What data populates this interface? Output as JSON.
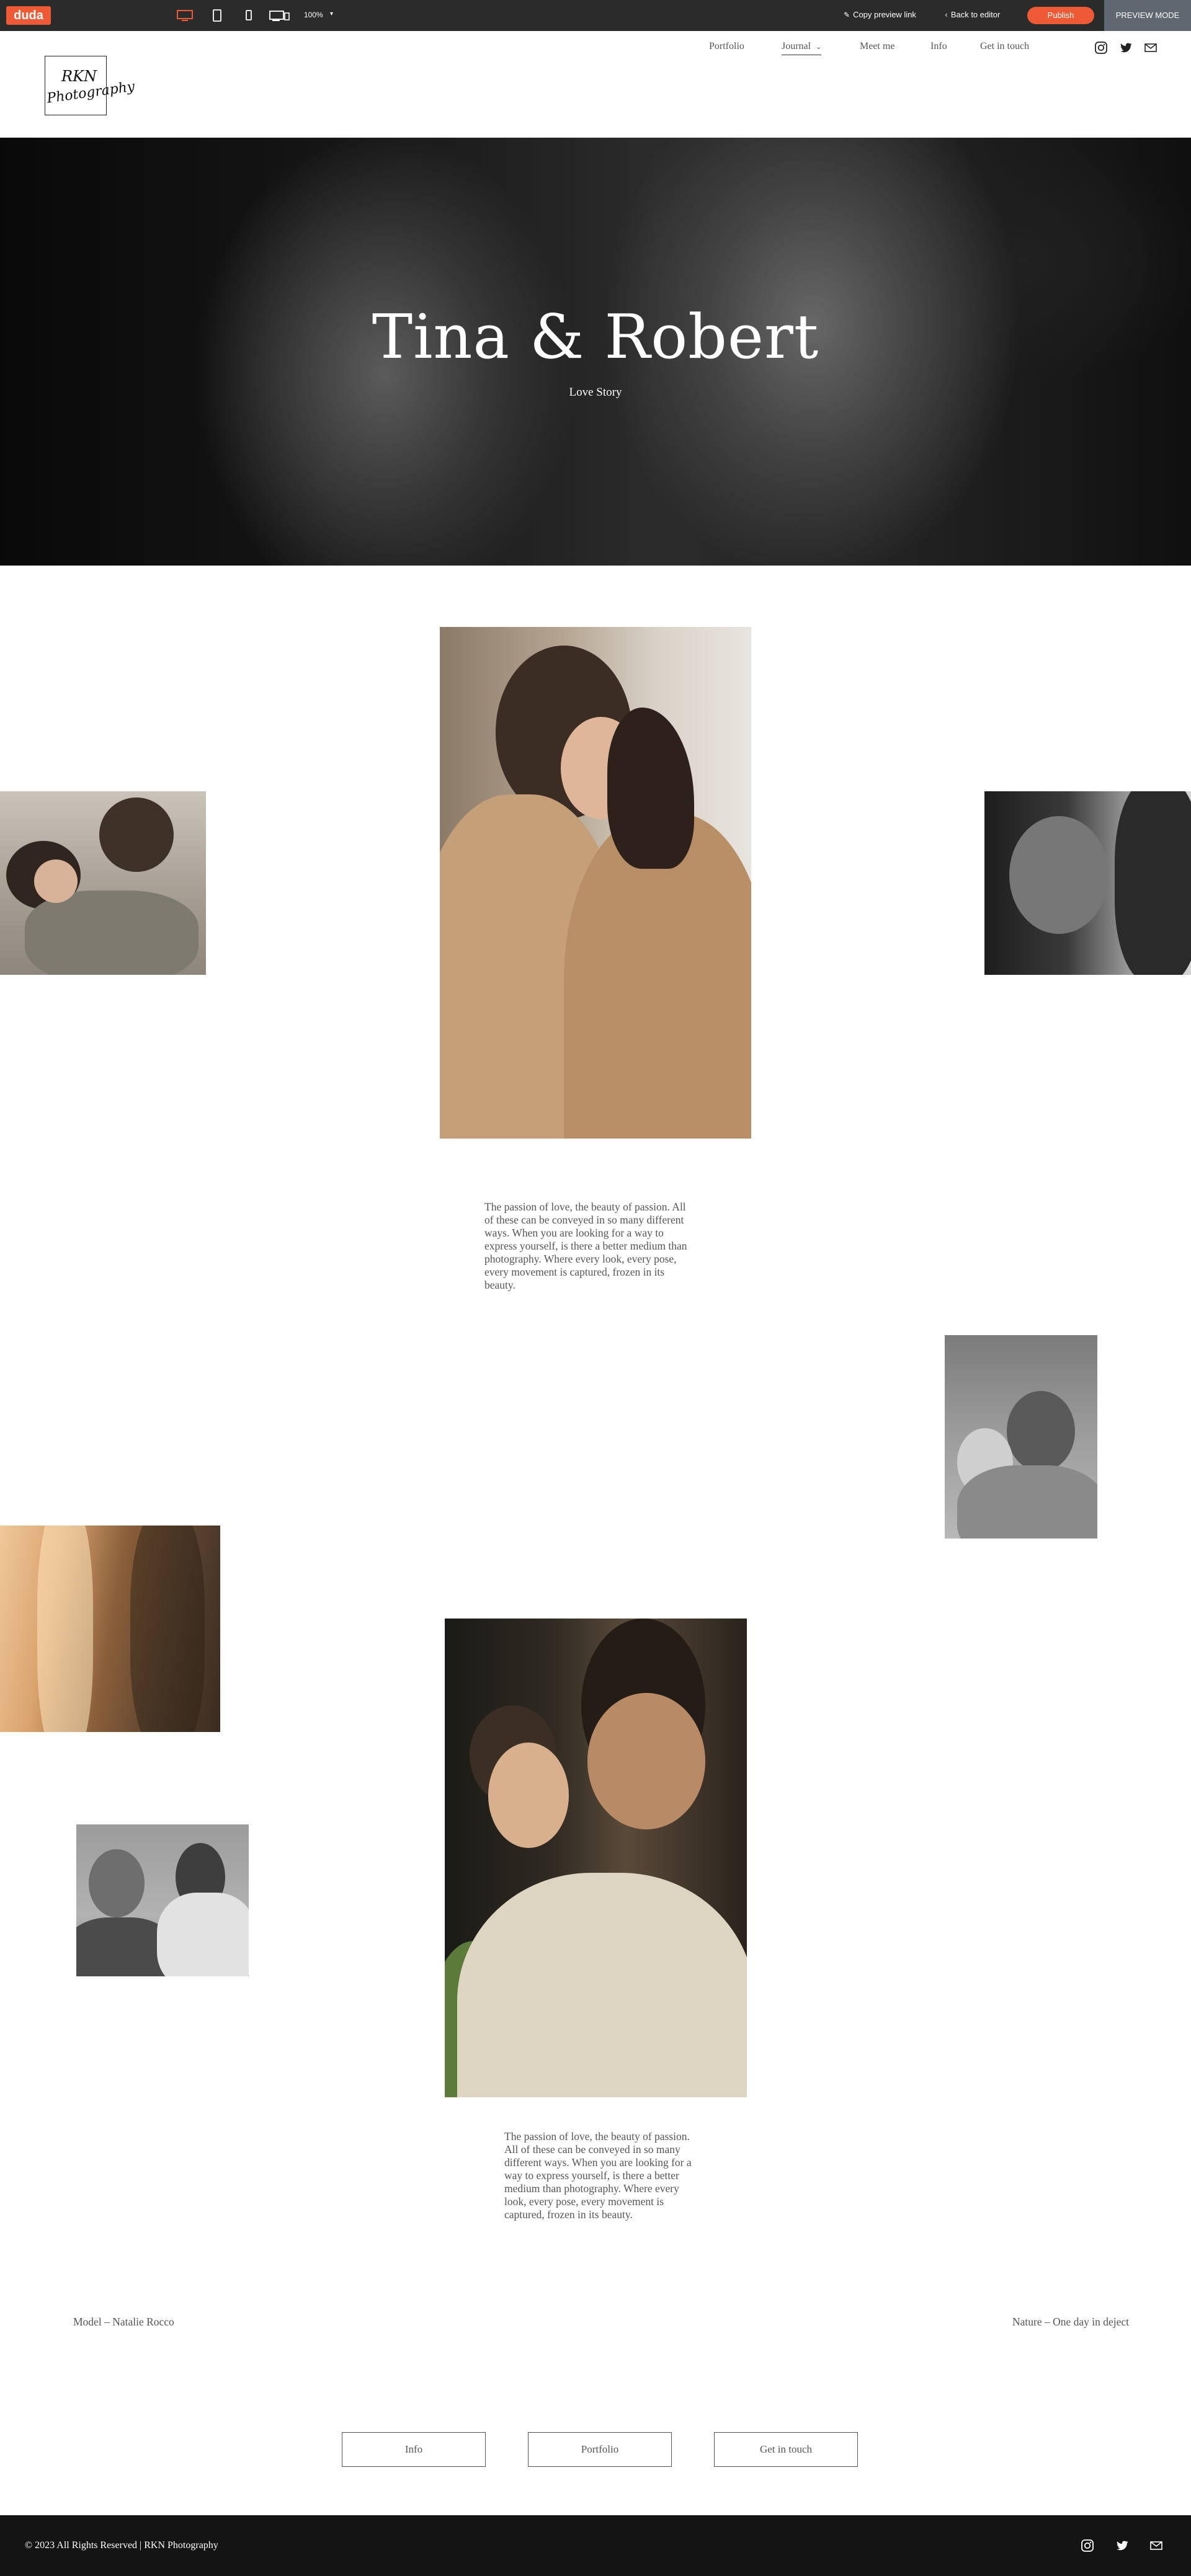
{
  "editor_bar": {
    "logo": "duda",
    "zoom": "100%",
    "copy_link": "Copy preview link",
    "back_to_editor": "Back to editor",
    "publish": "Publish",
    "preview_mode": "PREVIEW MODE",
    "accent_color": "#ee5a35"
  },
  "site": {
    "logo_line1": "RKN",
    "logo_line2": "Photography",
    "nav": [
      "Portfolio",
      "Journal",
      "Meet me",
      "Info",
      "Get in touch"
    ],
    "active_nav": "Journal",
    "social_icons": [
      "instagram-icon",
      "twitter-icon",
      "mail-icon"
    ]
  },
  "hero": {
    "title": "Tina & Robert",
    "subtitle": "Love Story"
  },
  "content": {
    "paragraph_1": "The passion of love, the beauty of passion. All of these can be conveyed in so many different ways. When you are looking for a way to express yourself, is there a better medium than photography. Where every look, every pose, every movement is captured, frozen in its beauty.",
    "paragraph_2": "The passion of love, the beauty of passion. All of these can be conveyed in so many different ways. When you are looking for a way to express yourself, is there a better medium than photography. Where every look, every pose, every movement is captured, frozen in its beauty.",
    "caption_left": "Model – Natalie Rocco",
    "caption_right": "Nature – One day in deject"
  },
  "buttons": [
    "Info",
    "Portfolio",
    "Get in touch"
  ],
  "footer": {
    "copyright": "© 2023 All Rights Reserved | RKN Photography"
  }
}
